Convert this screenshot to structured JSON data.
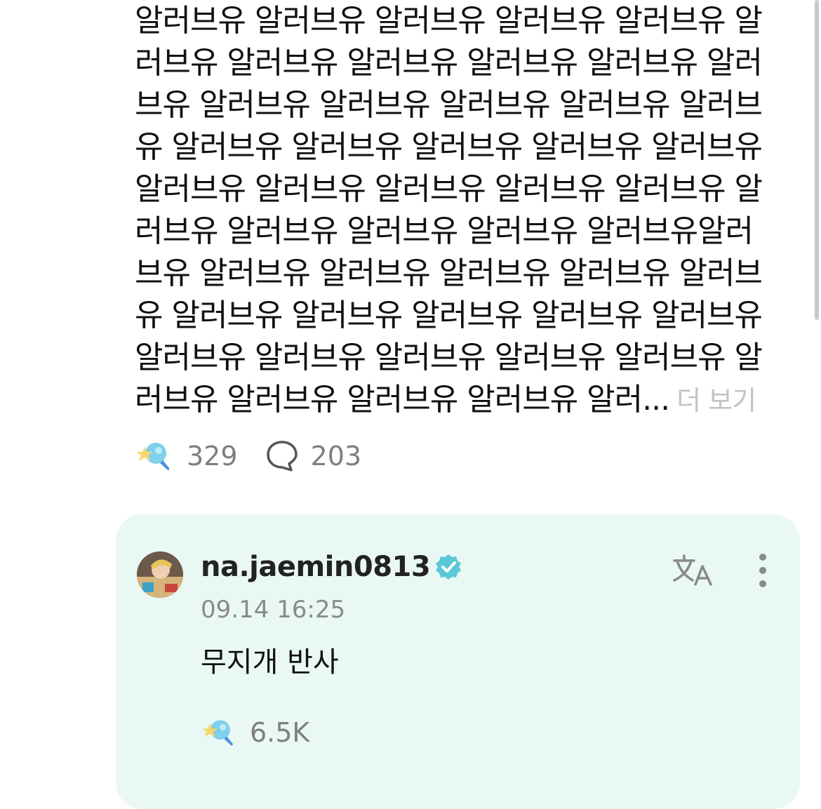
{
  "post": {
    "lines": [
      "알러브유 알러브유 알러브유 알러브유 알러브유 알",
      "러브유 알러브유 알러브유 알러브유 알러브유 알러",
      "브유 알러브유 알러브유 알러브유 알러브유 알러브",
      "유 알러브유 알러브유 알러브유 알러브유 알러브유",
      "알러브유 알러브유 알러브유 알러브유 알러브유 알",
      "러브유 알러브유 알러브유 알러브유 알러브유알러",
      "브유 알러브유 알러브유 알러브유 알러브유 알러브",
      "유 알러브유 알러브유 알러브유 알러브유 알러브유",
      "알러브유 알러브유 알러브유 알러브유 알러브유 알",
      "러브유 알러브유 알러브유 알러브유 알러..."
    ],
    "see_more": "더 보기",
    "reaction_count": "329",
    "comment_count": "203"
  },
  "comment": {
    "username": "na.jaemin0813",
    "timestamp": "09.14 16:25",
    "text": "무지개 반사",
    "reaction_count": "6.5K"
  },
  "icons": {
    "reaction": "star-lollipop-icon",
    "comment": "speech-bubble-icon",
    "verified": "verified-badge-icon",
    "translate": "translate-icon",
    "more": "more-vertical-icon"
  },
  "colors": {
    "card_background": "#e9f8f5",
    "verified": "#5bc8d8",
    "reaction_blue": "#6ec9e6",
    "reaction_star": "#f7d76a",
    "muted_text": "#8a8a8a"
  }
}
